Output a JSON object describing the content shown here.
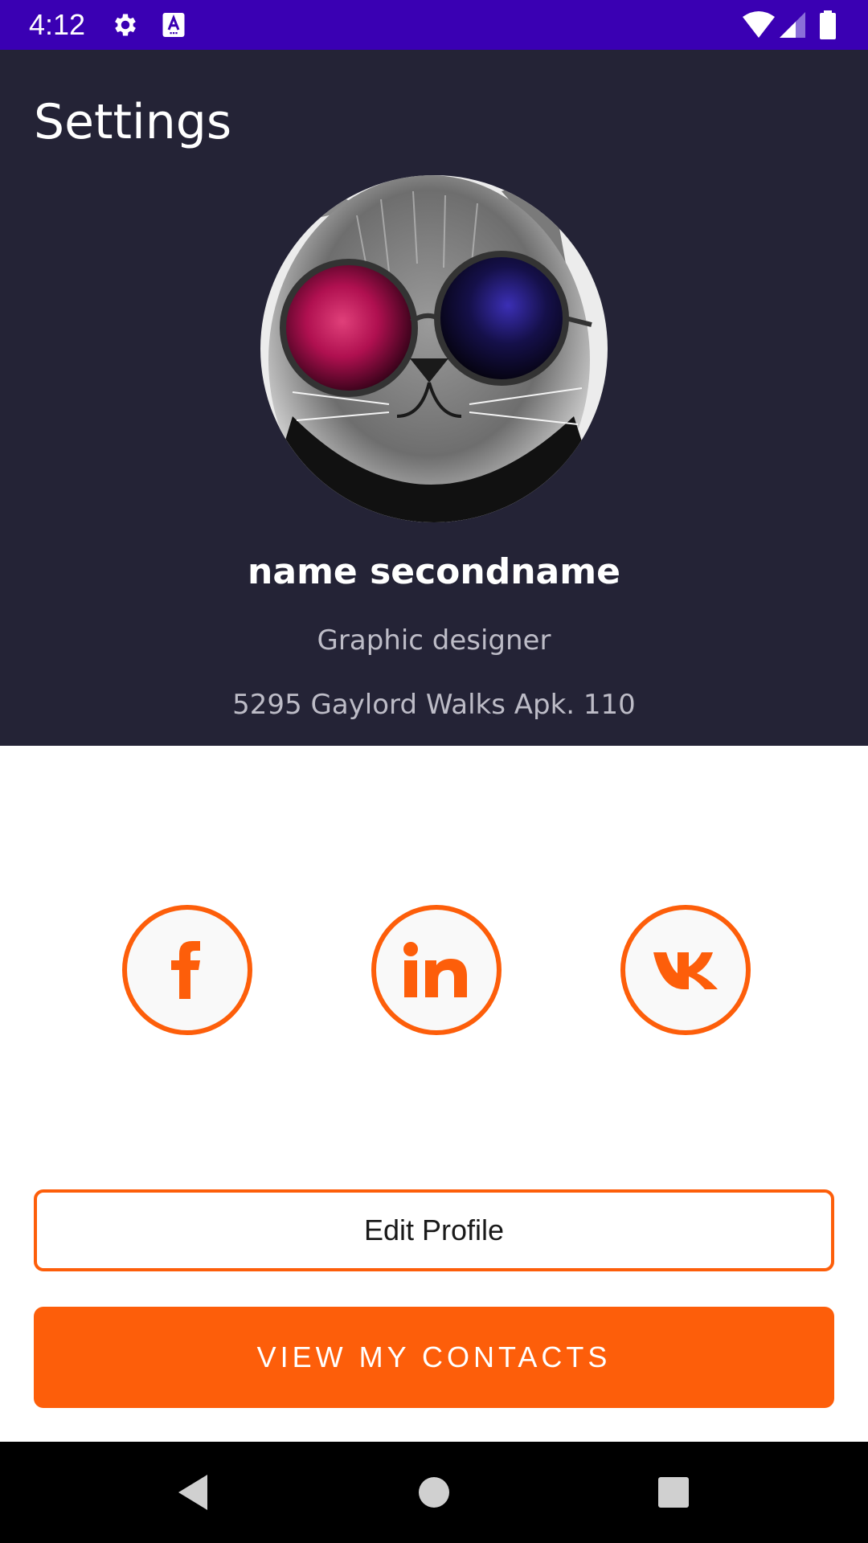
{
  "status_bar": {
    "time": "4:12",
    "left_icons": [
      "gear-icon",
      "text-a-icon"
    ],
    "right_icons": [
      "wifi-icon",
      "cell-signal-icon",
      "battery-icon"
    ],
    "background_color": "#3a00b3"
  },
  "header": {
    "title": "Settings",
    "background_color": "#242336"
  },
  "profile": {
    "avatar": "cat-with-galaxy-sunglasses",
    "name": "name secondname",
    "role": "Graphic designer",
    "address": "5295 Gaylord Walks Apk. 110"
  },
  "social": {
    "accent_color": "#fd5e0a",
    "items": [
      {
        "icon": "facebook-icon",
        "glyph": "f"
      },
      {
        "icon": "linkedin-icon",
        "glyph": "in"
      },
      {
        "icon": "vk-icon",
        "glyph": "vk"
      }
    ]
  },
  "actions": {
    "edit_label": "Edit Profile",
    "contacts_label": "VIEW MY CONTACTS"
  },
  "nav_bar": {
    "buttons": [
      "back-icon",
      "home-icon",
      "recents-icon"
    ]
  }
}
